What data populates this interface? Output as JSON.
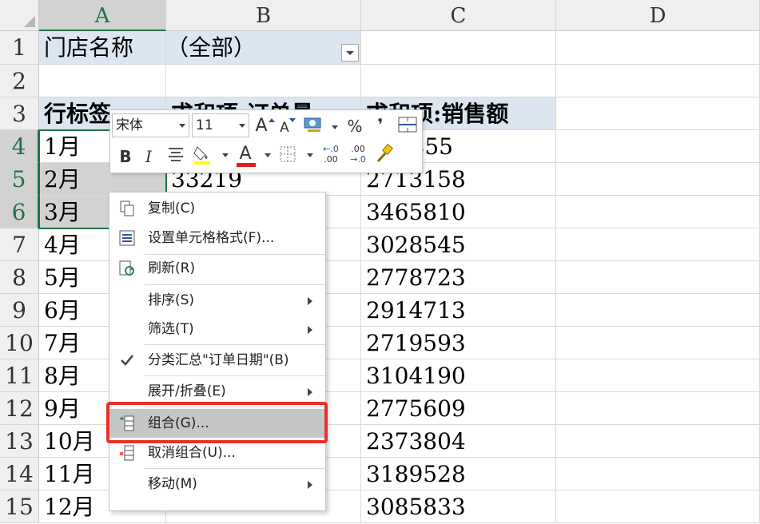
{
  "columns": [
    "A",
    "B",
    "C",
    "D"
  ],
  "rows": [
    "1",
    "2",
    "3",
    "4",
    "5",
    "6",
    "7",
    "8",
    "9",
    "10",
    "11",
    "12",
    "13",
    "14",
    "15"
  ],
  "pivot": {
    "filter_label": "门店名称",
    "filter_value": "（全部）",
    "header_row_label": "行标签",
    "header_b": "求和项:订单量",
    "header_c": "求和项:销售额",
    "months": [
      "1月",
      "2月",
      "3月",
      "4月",
      "5月",
      "6月",
      "7月",
      "8月",
      "9月",
      "10月",
      "11月",
      "12月"
    ],
    "col_b_values": [
      "",
      "33219",
      "",
      "",
      "",
      "",
      "",
      "",
      "",
      "",
      "",
      ""
    ],
    "col_c_values": [
      "855",
      "2713158",
      "3465810",
      "3028545",
      "2778723",
      "2914713",
      "2719593",
      "3104190",
      "2775609",
      "2373804",
      "3189528",
      "3085833"
    ]
  },
  "mini_toolbar": {
    "font_name": "宋体",
    "font_size": "11",
    "grow_font": "A",
    "shrink_font": "A",
    "percent": "%",
    "comma": "❜",
    "bold": "B",
    "italic": "I",
    "font_color_letter": "A",
    "decimal_inc_top": "←.0",
    "decimal_inc_bottom": ".00",
    "decimal_dec_top": ".00",
    "decimal_dec_bottom": "→.0",
    "font_color": "#e02020"
  },
  "context_menu": {
    "items": [
      {
        "label": "复制(C)",
        "icon": "copy-icon"
      },
      {
        "label": "设置单元格格式(F)...",
        "icon": "format-cells-icon"
      },
      {
        "label": "刷新(R)",
        "icon": "refresh-icon"
      },
      {
        "label": "排序(S)",
        "icon": ""
      },
      {
        "label": "筛选(T)",
        "icon": ""
      },
      {
        "label": "分类汇总\"订单日期\"(B)",
        "icon": "checkmark-icon"
      },
      {
        "label": "展开/折叠(E)",
        "icon": ""
      },
      {
        "label": "组合(G)...",
        "icon": "group-icon"
      },
      {
        "label": "取消组合(U)...",
        "icon": "ungroup-icon"
      },
      {
        "label": "移动(M)",
        "icon": ""
      }
    ]
  },
  "colors": {
    "selection_green": "#217346",
    "pivot_header_fill": "#dce6f1",
    "highlight_border": "#e8312a"
  }
}
